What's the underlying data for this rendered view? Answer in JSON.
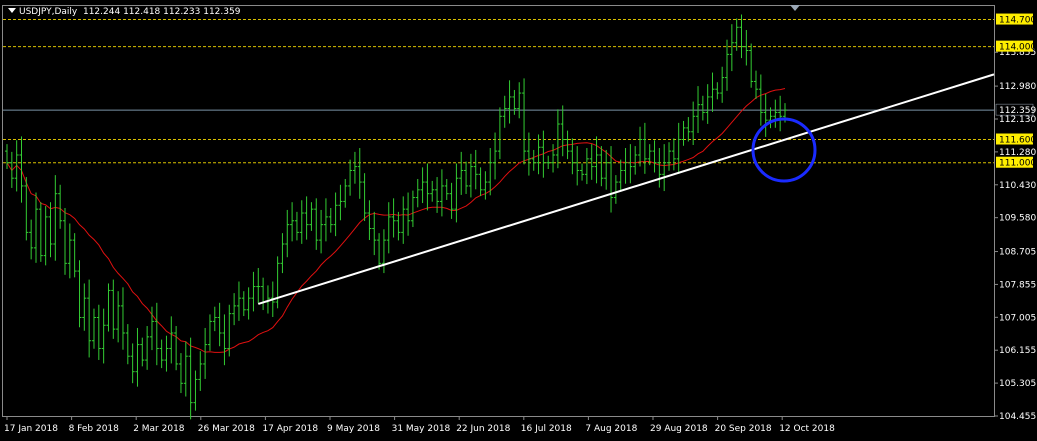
{
  "header": {
    "symbol": "USDJPY,Daily",
    "ohlc": "112.244 112.418 112.233 112.359"
  },
  "colors": {
    "background": "#000000",
    "candles": "#33cc33",
    "moving_average": "#e01010",
    "trendline": "#ffffff",
    "level_lines": "#d8c000",
    "current_price_line": "#7a93a6",
    "level_label_bg": "#ffee00",
    "circle": "#1a2bff"
  },
  "chart_data": {
    "type": "candlestick",
    "symbol": "USDJPY",
    "timeframe": "Daily",
    "ylim": [
      104.455,
      115.05
    ],
    "y_ticks": [
      "104.455",
      "105.305",
      "106.155",
      "107.005",
      "107.855",
      "108.705",
      "109.580",
      "110.430",
      "111.280",
      "112.130",
      "112.980",
      "113.855"
    ],
    "x_ticks": [
      "17 Jan 2018",
      "8 Feb 2018",
      "2 Mar 2018",
      "26 Mar 2018",
      "17 Apr 2018",
      "9 May 2018",
      "31 May 2018",
      "22 Jun 2018",
      "16 Jul 2018",
      "7 Aug 2018",
      "29 Aug 2018",
      "20 Sep 2018",
      "12 Oct 2018"
    ],
    "horizontal_levels": [
      114.7,
      114.0,
      111.6,
      111.0
    ],
    "level_labels": [
      "114.700",
      "114.000",
      "111.600",
      "111.000"
    ],
    "current_price": 112.359,
    "current_price_label": "112.359",
    "closes": [
      111.0,
      110.6,
      111.2,
      110.4,
      109.2,
      108.8,
      109.8,
      108.6,
      109.6,
      108.9,
      110.2,
      109.5,
      108.4,
      109.0,
      108.2,
      107.0,
      107.5,
      106.4,
      107.0,
      106.2,
      106.8,
      107.7,
      106.7,
      107.3,
      106.6,
      106.0,
      105.6,
      106.3,
      105.9,
      106.5,
      106.9,
      106.2,
      105.9,
      106.2,
      106.6,
      105.8,
      105.3,
      106.0,
      104.8,
      105.4,
      105.8,
      106.3,
      106.9,
      107.0,
      106.6,
      106.2,
      107.1,
      107.3,
      107.5,
      107.2,
      107.5,
      107.8,
      107.8,
      107.4,
      107.5,
      107.4,
      108.4,
      108.9,
      109.4,
      109.5,
      109.2,
      109.7,
      109.4,
      109.8,
      109.0,
      109.4,
      109.6,
      109.4,
      109.9,
      110.0,
      110.4,
      110.8,
      110.9,
      110.5,
      109.7,
      109.3,
      109.0,
      108.4,
      109.0,
      109.6,
      109.5,
      109.2,
      109.8,
      109.5,
      110.1,
      110.3,
      110.5,
      110.2,
      110.3,
      110.0,
      110.4,
      110.2,
      109.8,
      110.6,
      110.8,
      110.4,
      110.9,
      110.7,
      110.3,
      110.5,
      111.0,
      111.3,
      112.2,
      112.4,
      112.7,
      112.4,
      112.8,
      111.3,
      111.1,
      111.0,
      111.4,
      111.0,
      111.0,
      111.2,
      112.0,
      111.6,
      111.3,
      111.0,
      110.8,
      110.7,
      111.1,
      110.9,
      111.2,
      110.6,
      111.0,
      110.1,
      110.5,
      110.8,
      111.0,
      110.9,
      111.2,
      111.6,
      111.1,
      111.3,
      111.0,
      110.7,
      111.0,
      111.3,
      111.1,
      111.6,
      111.9,
      111.8,
      112.2,
      112.5,
      112.3,
      112.7,
      112.9,
      112.8,
      113.2,
      113.8,
      114.1,
      114.5,
      114.0,
      113.9,
      113.1,
      112.9,
      112.3,
      112.1,
      112.2,
      112.3,
      112.2,
      112.36
    ]
  }
}
